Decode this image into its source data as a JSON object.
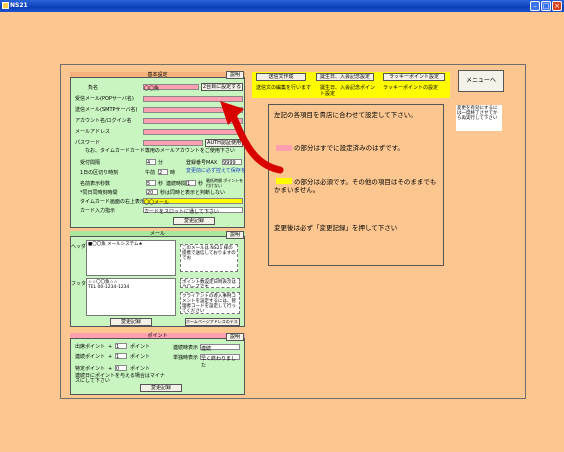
{
  "window": {
    "title": "NS21"
  },
  "basic": {
    "title": "基本設定",
    "help": "説明",
    "shop_label": "負名",
    "shop_value": "〇〇魚",
    "second_btn": "2台目に設定する",
    "recv_label": "受信メール(POPサーバ名)",
    "send_label": "送信メール(SMTPサーバ名)",
    "account_label": "アカウント名/ログイン名",
    "mail_label": "メールアドレス",
    "password_label": "パスワード",
    "auth_btn": "AUTH認証使用",
    "note": "なお、タイムカードカード専用のメールアカウントをご使用下さい",
    "hours_label": "受付間隔",
    "hours_value": "4",
    "hours_unit": "分",
    "max_label": "登録番号MAX",
    "max_value": "9999",
    "max_note": "変更前に必ず控えて保存を",
    "day_label": "1日の区切り時刻",
    "ampm": "午前",
    "day_value": "2",
    "day_unit": "時",
    "lowest_label": "最新の同一警告欄",
    "name_label": "名前表示秒数",
    "name_value": "5",
    "name_unit": "秒",
    "interval_label": "連続時間",
    "interval_value": "1",
    "interval_unit": "秒",
    "lowest_note": "最低時間 ポイントを付けない",
    "same_label": "*同日同時刻時間",
    "same_value": "20",
    "same_note": "秒は同時と表示と判断しない",
    "timecard_label": "タイムカード画面の右上表示",
    "timecard_value": "〇〇メール",
    "cardinfo_label": "カード入力指示",
    "cardinfo_value": "カードをスロットに通して下さい",
    "save_btn": "変更記録"
  },
  "top_buttons": {
    "b1": "送信文作成",
    "b2": "誕生日、入会記念設定",
    "b3": "ラッキーポイント設定",
    "info1": "送信文の編集を行います",
    "info2": "誕生日、入会記念ポイント設定",
    "info3": "ラッキーポイントの設定",
    "menu_btn": "メニューへ",
    "side_note": "変更を有効にするには一度終了させてから再実行して下さい"
  },
  "message": {
    "line1": "左記の各項目を貴店に合わせて設定して下さい。",
    "line2": "の部分はすでに設定済みのはずです。",
    "line3": "の部分は必須です。その他の項目はそのままでもかまいません。",
    "line4": "変更後は必ず「変更記録」を押して下さい"
  },
  "mail": {
    "title": "メール",
    "help": "説明",
    "header_label": "ヘッダ",
    "header_text": "■〇〇魚 メールシステム★",
    "header_note": "このメールは NS21 様の提携で送信しておりますのでお",
    "footer_label": "フッタ",
    "footer_text1": "☆☆〇〇魚☆☆",
    "footer_text2": "TEL 00-1234-1234",
    "footer_note1": "ポイント数設定日時表示はクローズです",
    "footer_note2": "クライアントの導入事例コメントを設定するには、管理者コードを設定して行ってください",
    "save_btn": "変更記録",
    "home_btn": "ホームページアドレスのテスト"
  },
  "point": {
    "title": "ポイント",
    "help": "説明",
    "arrival_label": "出席ポイント",
    "arrival_value": "1",
    "arrival_unit": "ポイント",
    "consec_label": "連続ポイント",
    "consec_value": "1",
    "consec_unit": "ポイント",
    "special_label": "特定ポイント",
    "special_value": "0",
    "special_unit": "ポイント",
    "note": "連続日にポイントを与える場合はマイナスにして下さい",
    "disp_label": "連続時表示",
    "disp_value": "連続",
    "single_label": "単独時表示",
    "single_value": "早く終わりました",
    "save_btn": "変更記録"
  },
  "colors": {
    "background": "#fbc690",
    "pink": "#ff9fb0",
    "yellow": "#fffb00",
    "green": "#c8f5c0",
    "arrow": "#d90000"
  }
}
